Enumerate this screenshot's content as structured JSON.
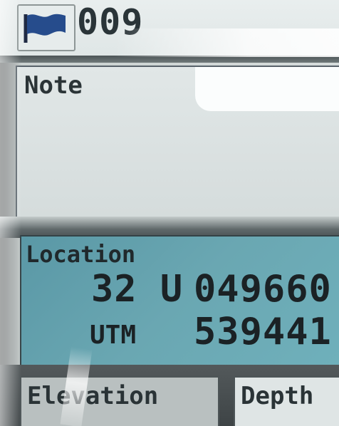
{
  "header": {
    "icon": "flag-icon",
    "waypoint_number": "009"
  },
  "note": {
    "label": "Note",
    "value": ""
  },
  "location": {
    "label": "Location",
    "zone": "32 U",
    "easting": "049660",
    "format": "UTM",
    "northing": "539441"
  },
  "fields": {
    "elevation_label": "Elevation",
    "depth_label": "Depth"
  },
  "colors": {
    "location_highlight": "#6aa7b2",
    "screen_background": "#d6dcdb",
    "text": "#1b2225"
  }
}
